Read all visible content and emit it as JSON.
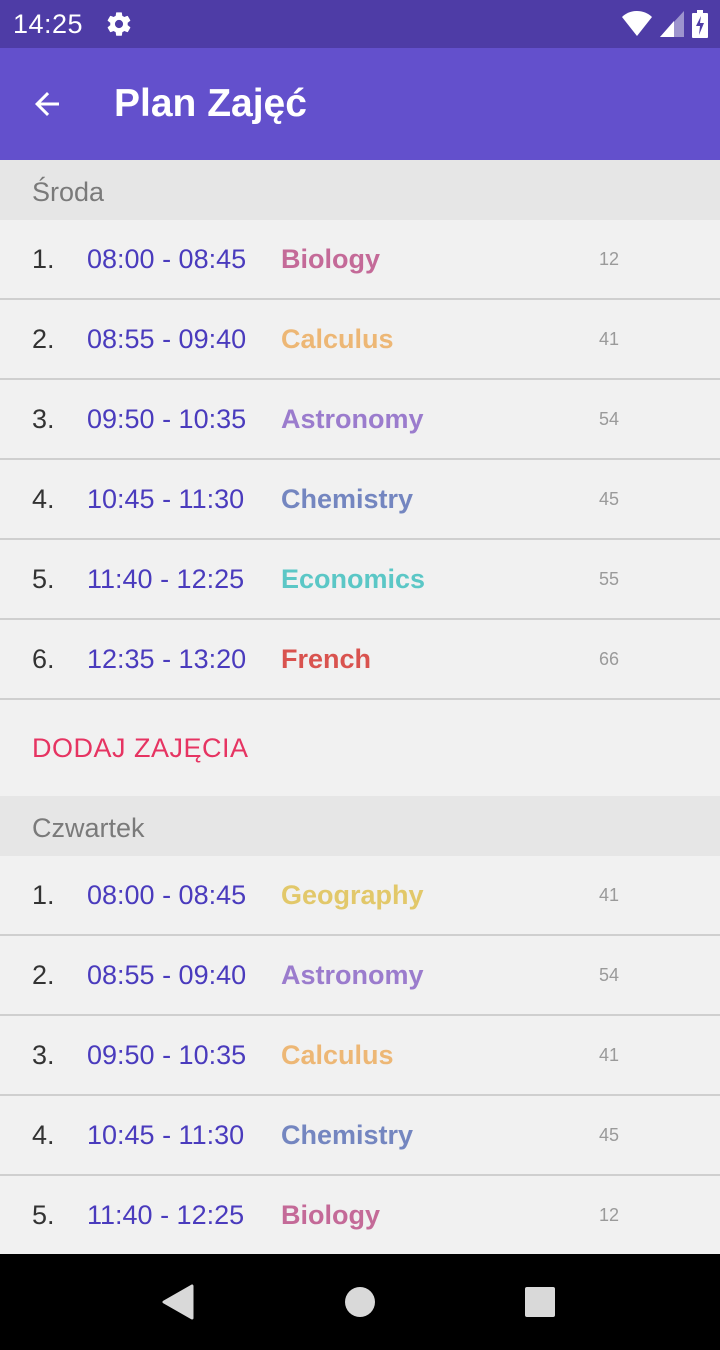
{
  "status_bar": {
    "time": "14:25"
  },
  "app_bar": {
    "title": "Plan Zajęć"
  },
  "days": [
    {
      "name": "Środa",
      "lessons": [
        {
          "num": "1.",
          "time": "08:00 - 08:45",
          "subject": "Biology",
          "room": "12",
          "color": "#c46a98"
        },
        {
          "num": "2.",
          "time": "08:55 - 09:40",
          "subject": "Calculus",
          "room": "41",
          "color": "#edb775"
        },
        {
          "num": "3.",
          "time": "09:50 - 10:35",
          "subject": "Astronomy",
          "room": "54",
          "color": "#9b7ccd"
        },
        {
          "num": "4.",
          "time": "10:45 - 11:30",
          "subject": "Chemistry",
          "room": "45",
          "color": "#7486c0"
        },
        {
          "num": "5.",
          "time": "11:40 - 12:25",
          "subject": "Economics",
          "room": "55",
          "color": "#5bc7c6"
        },
        {
          "num": "6.",
          "time": "12:35 - 13:20",
          "subject": "French",
          "room": "66",
          "color": "#d9534f"
        }
      ],
      "add_label": "DODAJ ZAJĘCIA"
    },
    {
      "name": "Czwartek",
      "lessons": [
        {
          "num": "1.",
          "time": "08:00 - 08:45",
          "subject": "Geography",
          "room": "41",
          "color": "#e2c86a"
        },
        {
          "num": "2.",
          "time": "08:55 - 09:40",
          "subject": "Astronomy",
          "room": "54",
          "color": "#9b7ccd"
        },
        {
          "num": "3.",
          "time": "09:50 - 10:35",
          "subject": "Calculus",
          "room": "41",
          "color": "#edb775"
        },
        {
          "num": "4.",
          "time": "10:45 - 11:30",
          "subject": "Chemistry",
          "room": "45",
          "color": "#7486c0"
        },
        {
          "num": "5.",
          "time": "11:40 - 12:25",
          "subject": "Biology",
          "room": "12",
          "color": "#c46a98"
        }
      ]
    }
  ],
  "colors": {
    "status_bar": "#4e3ca6",
    "app_bar": "#6350cc",
    "time_text": "#4a3bbd",
    "add_button": "#e63462"
  },
  "icons": {
    "status": [
      "gear-icon",
      "wifi-icon",
      "signal-icon",
      "battery-icon"
    ],
    "app_bar": "arrow-back-icon",
    "navigation": [
      "nav-back-icon",
      "nav-home-icon",
      "nav-recents-icon"
    ]
  }
}
